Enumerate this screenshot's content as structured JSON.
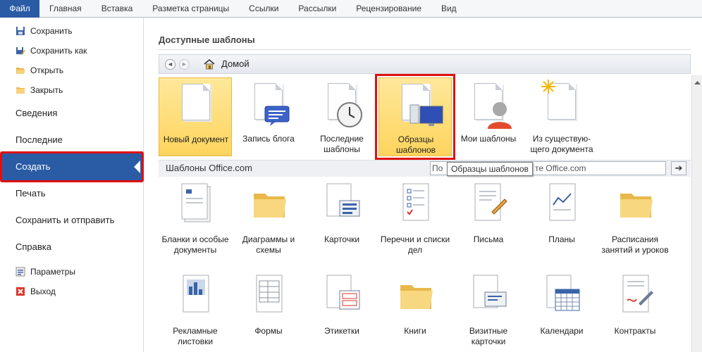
{
  "ribbon": {
    "file_tab": "Файл",
    "tabs": [
      "Главная",
      "Вставка",
      "Разметка страницы",
      "Ссылки",
      "Рассылки",
      "Рецензирование",
      "Вид"
    ]
  },
  "nav": {
    "save": "Сохранить",
    "save_as": "Сохранить как",
    "open": "Открыть",
    "close": "Закрыть",
    "info": "Сведения",
    "recent": "Последние",
    "new": "Создать",
    "print": "Печать",
    "save_send": "Сохранить и отправить",
    "help": "Справка",
    "options": "Параметры",
    "exit": "Выход"
  },
  "content": {
    "title": "Доступные шаблоны",
    "back": "◄",
    "forward": "►",
    "home": "Домой",
    "top_templates": [
      {
        "label": "Новый документ",
        "name": "new-document"
      },
      {
        "label": "Запись блога",
        "name": "blog-post"
      },
      {
        "label": "Последние шаблоны",
        "name": "recent-templates"
      },
      {
        "label": "Образцы шаблонов",
        "name": "sample-templates"
      },
      {
        "label": "Мои шаблоны",
        "name": "my-templates"
      },
      {
        "label": "Из существую-щего документа",
        "name": "from-existing"
      }
    ],
    "office_label": "Шаблоны Office.com",
    "search_value": "По",
    "search_tail": "те Office.com",
    "tooltip": "Образцы шаблонов",
    "office_templates": [
      "Бланки и особые документы",
      "Диаграммы и схемы",
      "Карточки",
      "Перечни и списки дел",
      "Письма",
      "Планы",
      "Расписания занятий и уроков",
      "Рекламные листовки",
      "Формы",
      "Этикетки",
      "Книги",
      "Визитные карточки",
      "Календари",
      "Контракты"
    ]
  }
}
